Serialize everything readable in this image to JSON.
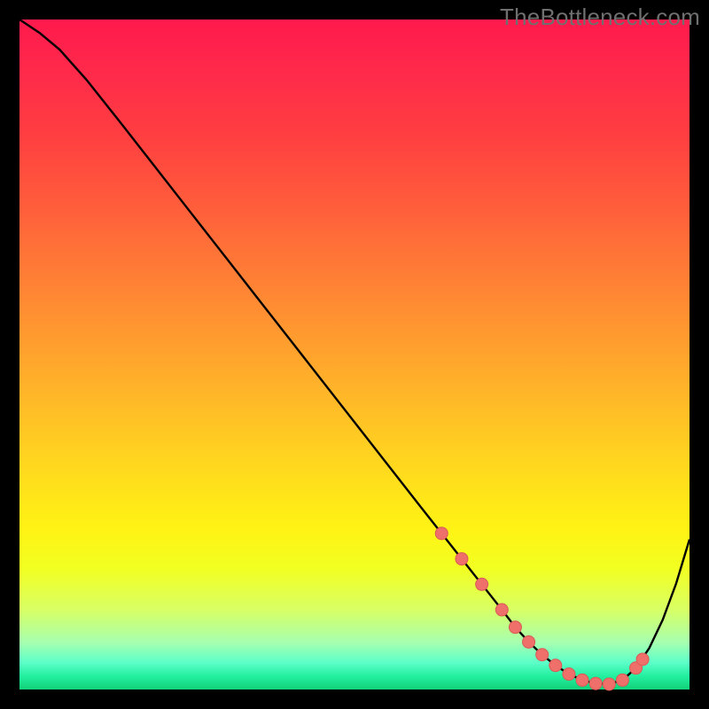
{
  "watermark": "TheBottleneck.com",
  "colors": {
    "background": "#000000",
    "curve": "#000000",
    "marker_fill": "#ef6f6a",
    "marker_stroke": "#d95a56"
  },
  "chart_data": {
    "type": "line",
    "title": "",
    "xlabel": "",
    "ylabel": "",
    "xlim": [
      0,
      100
    ],
    "ylim": [
      0,
      100
    ],
    "x": [
      0,
      3,
      6,
      10,
      15,
      20,
      25,
      30,
      35,
      40,
      45,
      50,
      55,
      60,
      63,
      66,
      69,
      72,
      74,
      76,
      78,
      80,
      82,
      84,
      86,
      88,
      90,
      92,
      94,
      96,
      98,
      100
    ],
    "values": [
      100,
      98,
      95.5,
      91,
      84.7,
      78.3,
      71.9,
      65.5,
      59.1,
      52.7,
      46.3,
      39.9,
      33.5,
      27.1,
      23.3,
      19.5,
      15.7,
      11.9,
      9.3,
      7.1,
      5.2,
      3.6,
      2.3,
      1.4,
      0.9,
      0.8,
      1.4,
      3.2,
      6.2,
      10.4,
      15.8,
      22.4
    ],
    "markers_x": [
      63,
      66,
      69,
      72,
      74,
      76,
      78,
      80,
      82,
      84,
      86,
      88,
      90,
      92,
      93
    ],
    "markers_y": [
      23.3,
      19.5,
      15.7,
      11.9,
      9.3,
      7.1,
      5.2,
      3.6,
      2.3,
      1.4,
      0.9,
      0.8,
      1.4,
      3.2,
      4.5
    ]
  }
}
